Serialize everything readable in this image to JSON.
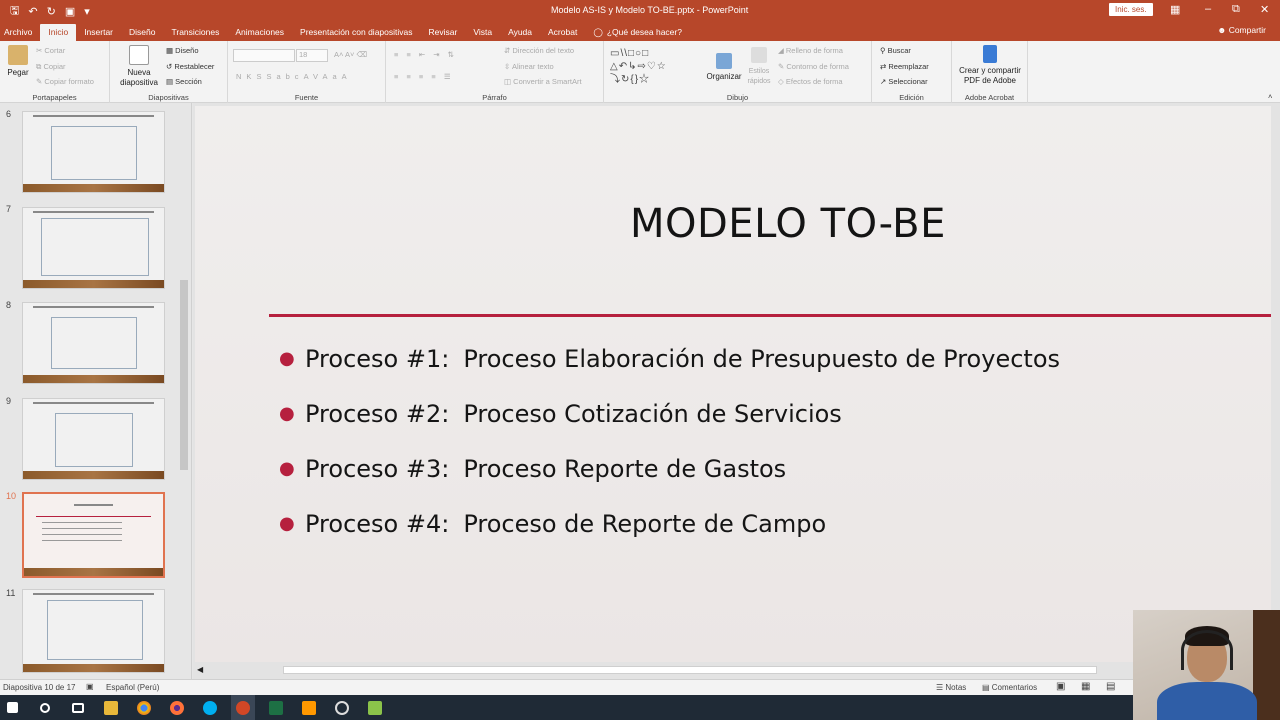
{
  "titlebar": {
    "document_title": "Modelo AS-IS y Modelo TO-BE.pptx  -  PowerPoint",
    "sign_in": "Inic. ses.",
    "brand_color": "#b7472a"
  },
  "tabs": [
    "Archivo",
    "Inicio",
    "Insertar",
    "Diseño",
    "Transiciones",
    "Animaciones",
    "Presentación con diapositivas",
    "Revisar",
    "Vista",
    "Ayuda",
    "Acrobat"
  ],
  "tell_me": "¿Qué desea hacer?",
  "share": "Compartir",
  "ribbon": {
    "clipboard": {
      "paste": "Pegar",
      "cut": "Cortar",
      "copy": "Copiar",
      "format_painter": "Copiar formato",
      "label": "Portapapeles"
    },
    "slides": {
      "new_slide": "Nueva diapositiva",
      "layout": "Diseño",
      "reset": "Restablecer",
      "section": "Sección",
      "label": "Diapositivas"
    },
    "font": {
      "size": "18",
      "label": "Fuente",
      "buttons": [
        "N",
        "K",
        "S",
        "S",
        "abc",
        "AV",
        "Aa",
        "A"
      ]
    },
    "paragraph": {
      "text_direction": "Dirección del texto",
      "align_text": "Alinear texto",
      "convert_smartart": "Convertir a SmartArt",
      "label": "Párrafo"
    },
    "drawing": {
      "arrange": "Organizar",
      "quick_styles": "Estilos rápidos",
      "shape_fill": "Relleno de forma",
      "shape_outline": "Contorno de forma",
      "shape_effects": "Efectos de forma",
      "label": "Dibujo"
    },
    "editing": {
      "find": "Buscar",
      "replace": "Reemplazar",
      "select": "Seleccionar",
      "label": "Edición"
    },
    "acrobat": {
      "create": "Crear y compartir PDF de Adobe",
      "label": "Adobe Acrobat"
    }
  },
  "thumbnails": [
    {
      "number": "6"
    },
    {
      "number": "7"
    },
    {
      "number": "8"
    },
    {
      "number": "9"
    },
    {
      "number": "10",
      "selected": true
    },
    {
      "number": "11"
    }
  ],
  "slide": {
    "title": "MODELO TO-BE",
    "accent_color": "#b6203e",
    "bullets": [
      {
        "label": "Proceso #1:",
        "text": "Proceso Elaboración de Presupuesto de Proyectos"
      },
      {
        "label": "Proceso #2:",
        "text": "Proceso Cotización de Servicios"
      },
      {
        "label": "Proceso #3:",
        "text": "Proceso Reporte de Gastos"
      },
      {
        "label": "Proceso #4:",
        "text": "Proceso de Reporte de Campo"
      }
    ]
  },
  "statusbar": {
    "slide_counter": "Diapositiva 10 de 17",
    "language": "Español (Perú)",
    "notes": "Notas",
    "comments": "Comentarios"
  },
  "taskbar_icons": [
    "windows-start",
    "search",
    "task-view",
    "file-explorer",
    "chrome",
    "firefox",
    "skype",
    "powerpoint",
    "excel",
    "sublime",
    "obs",
    "android"
  ]
}
